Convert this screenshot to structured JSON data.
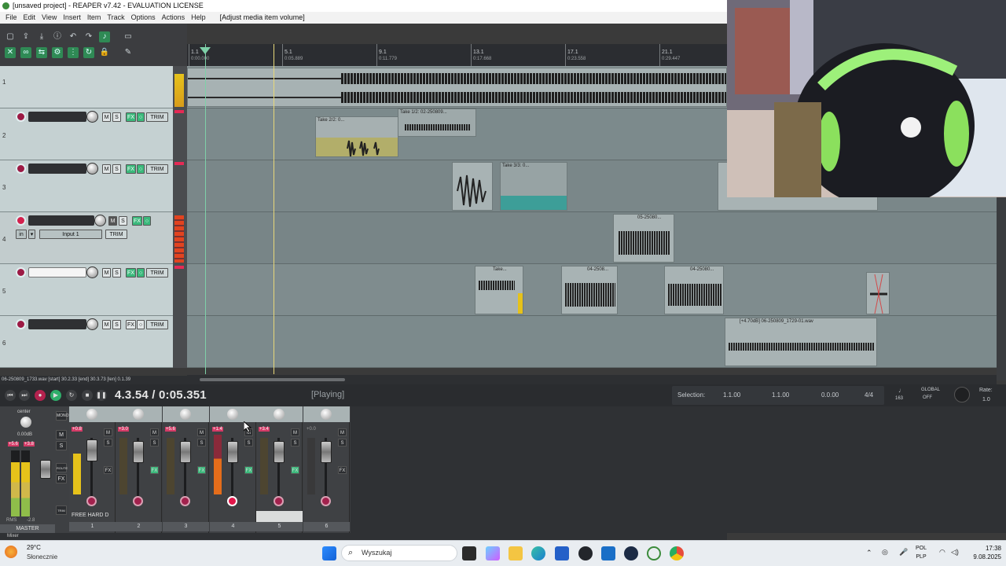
{
  "window": {
    "title": "[unsaved project] - REAPER v7.42 - EVALUATION LICENSE"
  },
  "menu": {
    "items": [
      "File",
      "Edit",
      "View",
      "Insert",
      "Item",
      "Track",
      "Options",
      "Actions",
      "Help"
    ],
    "action_hint": "[Adjust media item volume]"
  },
  "ruler": {
    "marks": [
      {
        "measure": "1.1",
        "time": "0:00.000"
      },
      {
        "measure": "5.1",
        "time": "0:05.889"
      },
      {
        "measure": "9.1",
        "time": "0:11.779"
      },
      {
        "measure": "13.1",
        "time": "0:17.668"
      },
      {
        "measure": "17.1",
        "time": "0:23.558"
      },
      {
        "measure": "21.1",
        "time": "0:29.447"
      }
    ]
  },
  "tracks": [
    {
      "number": "1",
      "name": "",
      "input_label": "",
      "fx": "FX",
      "trim": "TRIM"
    },
    {
      "number": "2",
      "name": "",
      "fx": "FX",
      "trim": "TRIM"
    },
    {
      "number": "3",
      "name": "",
      "fx": "FX",
      "trim": "TRIM"
    },
    {
      "number": "4",
      "name": "",
      "input_mode": "in",
      "input_label": "Input 1",
      "fx": "FX",
      "trim": "TRIM"
    },
    {
      "number": "5",
      "name": "",
      "fx": "FX",
      "trim": "TRIM"
    },
    {
      "number": "6",
      "name": "",
      "fx": "FX",
      "trim": "TRIM"
    }
  ],
  "buttons": {
    "mute": "M",
    "solo": "S",
    "fx": "FX",
    "trim": "TRIM"
  },
  "items": [
    {
      "label": "Take 2/2: 0..."
    },
    {
      "label": "Take 1/2: 02-250809..."
    },
    {
      "label": "Take 3/3: 0..."
    },
    {
      "label": "05-25080..."
    },
    {
      "label": "Take..."
    },
    {
      "label": "04-2508..."
    },
    {
      "label": "04-25080..."
    },
    {
      "label": "[+4.70dB] 06-250809_1729-01.wav"
    }
  ],
  "status_line": "06-250809_1733.wav [start] 30.2.33 [end] 30.3.73 [len] 0.1.39",
  "transport": {
    "time": "4.3.54 / 0:05.351",
    "state": "[Playing]",
    "selection_label": "Selection:",
    "sel_start": "1.1.00",
    "sel_end": "1.1.00",
    "sel_len": "0.0.00",
    "time_sig": "4/4",
    "bpm": "163",
    "global_label": "GLOBAL",
    "global_state": "OFF",
    "rate_label": "Rate:",
    "rate_value": "1.0"
  },
  "mixer": {
    "master_label": "MASTER",
    "master_pan": "center",
    "master_vol": "0.00dB",
    "master_peak_l": "+5.6",
    "master_peak_r": "+3.8",
    "master_rms": "RMS",
    "master_rms_val": "-2.8",
    "side_buttons": [
      "MONO",
      "M",
      "S",
      "ROUTE",
      "FX",
      "TRIM"
    ],
    "strips": [
      {
        "number": "1",
        "level": "+0.8",
        "name": "FREE HARD D",
        "fader_level": 0.55
      },
      {
        "number": "2",
        "level": "+3.0",
        "name": "",
        "fader_level": 0.5
      },
      {
        "number": "3",
        "level": "+5.6",
        "name": "",
        "fader_level": 0.5
      },
      {
        "number": "4",
        "level": "+1.4",
        "name": "",
        "fader_level": 0.5
      },
      {
        "number": "5",
        "level": "+3.4",
        "name": "",
        "fader_level": 0.5
      },
      {
        "number": "6",
        "level": "+0.0",
        "name": "",
        "fader_level": 0.5
      }
    ],
    "tab_label": "Mixer"
  },
  "taskbar": {
    "weather_temp": "29°C",
    "weather_desc": "Słonecznie",
    "search_placeholder": "Wyszukaj",
    "lang_top": "POL",
    "lang_bottom": "PLP",
    "time": "17:38",
    "date": "9.08.2025"
  },
  "colors": {
    "accent_green": "#3bb97c",
    "record_red": "#9c1a44",
    "meter_yellow": "#e6c21a",
    "meter_orange": "#e46d1b"
  }
}
